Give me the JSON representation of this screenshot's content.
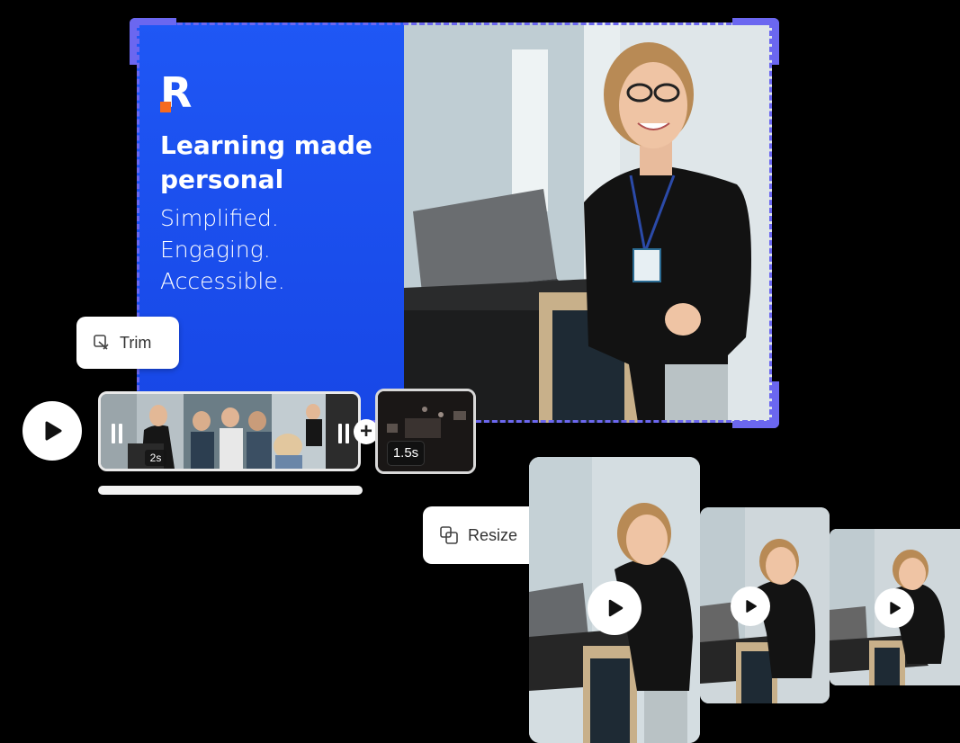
{
  "hero": {
    "logo_letter": "R",
    "headline": "Learning made personal",
    "taglines": [
      "Simplified.",
      "Engaging.",
      "Accessible."
    ],
    "brand_color": "#1d55f2",
    "accent_color": "#f66a1f",
    "selection_color": "#6b67f0"
  },
  "tools": {
    "trim_label": "Trim",
    "trim_icon": "trim-icon",
    "resize_label": "Resize",
    "resize_icon": "resize-icon"
  },
  "timeline": {
    "clip_duration": "2s",
    "next_clip_duration": "1.5s",
    "add_symbol": "+"
  }
}
